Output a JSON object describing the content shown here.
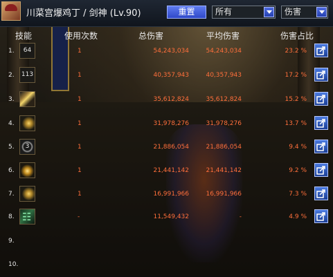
{
  "header": {
    "player_title": "川菜宫爆鸡丁 / 剑神 (Lv.90)",
    "reset_label": "重置",
    "filter_select": "所有",
    "metric_select": "伤害"
  },
  "columns": [
    "技能",
    "使用次数",
    "总伤害",
    "平均伤害",
    "伤害占比"
  ],
  "rows": [
    {
      "index": "1.",
      "icon": "skill-64",
      "icon_text": "64",
      "count": "1",
      "total": "54,243,034",
      "avg": "54,243,034",
      "share": "23.2 %"
    },
    {
      "index": "2.",
      "icon": "skill-113",
      "icon_text": "113",
      "count": "1",
      "total": "40,357,943",
      "avg": "40,357,943",
      "share": "17.2 %"
    },
    {
      "index": "3.",
      "icon": "crossed-swords",
      "icon_text": "",
      "count": "1",
      "total": "35,612,824",
      "avg": "35,612,824",
      "share": "15.2 %"
    },
    {
      "index": "4.",
      "icon": "sword-arcs",
      "icon_text": "",
      "count": "1",
      "total": "31,978,276",
      "avg": "31,978,276",
      "share": "13.7 %"
    },
    {
      "index": "5.",
      "icon": "dark-ring",
      "icon_text": "3",
      "count": "1",
      "total": "21,886,054",
      "avg": "21,886,054",
      "share": "9.4 %"
    },
    {
      "index": "6.",
      "icon": "golden-slash",
      "icon_text": "",
      "count": "1",
      "total": "21,441,142",
      "avg": "21,441,142",
      "share": "9.2 %"
    },
    {
      "index": "7.",
      "icon": "golden-arc",
      "icon_text": "",
      "count": "1",
      "total": "16,991,966",
      "avg": "16,991,966",
      "share": "7.3 %"
    },
    {
      "index": "8.",
      "icon": "green-glyph",
      "icon_text": "",
      "count": "-",
      "total": "11,549,432",
      "avg": "-",
      "share": "4.9 %"
    }
  ],
  "blank_rows": [
    "9.",
    "10."
  ],
  "colors": {
    "value_orange": "#ff6f3b",
    "header_blue": "#2f48c9"
  }
}
